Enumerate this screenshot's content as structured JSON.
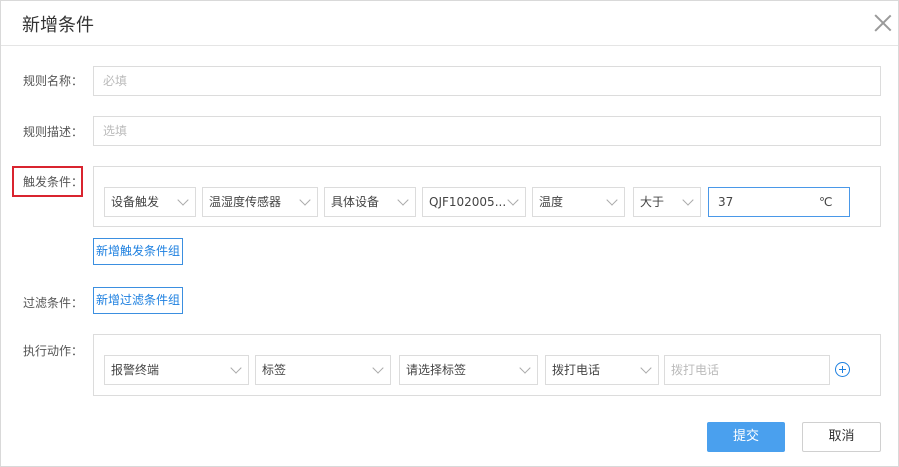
{
  "dialog": {
    "title": "新增条件",
    "rule_name": {
      "label": "规则名称：",
      "placeholder": "必填"
    },
    "rule_desc": {
      "label": "规则描述：",
      "placeholder": "选填"
    },
    "trigger": {
      "label": "触发条件：",
      "selects": [
        "设备触发",
        "温湿度传感器",
        "具体设备",
        "QJF102005...",
        "温度",
        "大于"
      ],
      "value": "37",
      "unit": "℃",
      "add_group": "新增触发条件组"
    },
    "filter": {
      "label": "过滤条件：",
      "add_group": "新增过滤条件组"
    },
    "action": {
      "label": "执行动作：",
      "selects": [
        "报警终端",
        "标签",
        "请选择标签",
        "拨打电话"
      ],
      "phone_placeholder": "拨打电话"
    },
    "submit": "提交",
    "cancel": "取消"
  }
}
